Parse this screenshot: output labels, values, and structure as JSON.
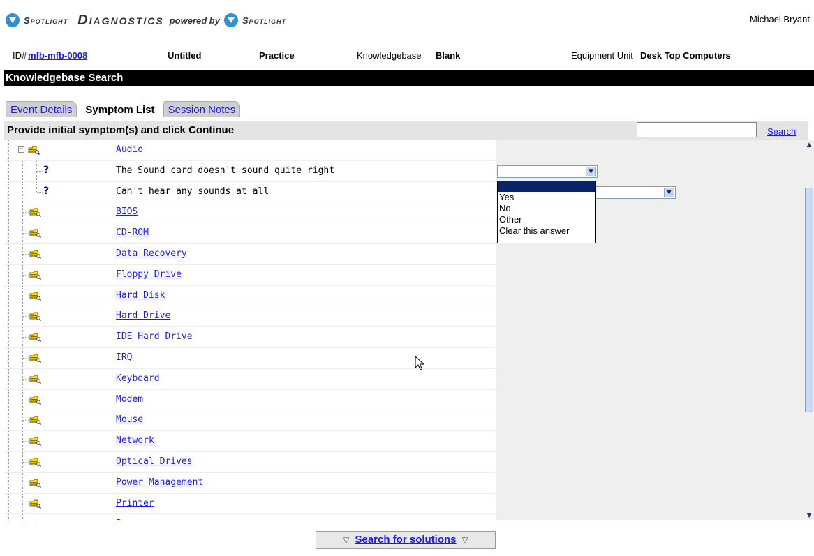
{
  "header": {
    "brand_small": "Spotlight",
    "brand_big": "Diagnostics",
    "powered_by": "powered by",
    "brand_small_2": "Spotlight",
    "user": "Michael Bryant"
  },
  "info": {
    "id_label": "ID#",
    "id_value": "mfb-mfb-0008",
    "title": "Untitled",
    "mode": "Practice",
    "kb_label": "Knowledgebase",
    "kb_value": "Blank",
    "eu_label": "Equipment Unit",
    "eu_value": "Desk Top Computers"
  },
  "section_title": "Knowledgebase Search",
  "tabs": [
    {
      "label": "Event Details",
      "active": false
    },
    {
      "label": "Symptom List",
      "active": true
    },
    {
      "label": "Session Notes",
      "active": false
    }
  ],
  "instruction": "Provide initial symptom(s) and click Continue",
  "search": {
    "value": "",
    "button": "Search"
  },
  "tree": {
    "expanded": {
      "label": "Audio",
      "children": [
        "The Sound card doesn't sound quite right",
        "Can't hear any sounds at all"
      ]
    },
    "categories": [
      "BIOS",
      "CD-ROM",
      "Data Recovery",
      "Floppy Drive",
      "Hard Disk",
      "Hard Drive",
      "IDE Hard Drive",
      "IRQ",
      "Keyboard",
      "Modem",
      "Mouse",
      "Network",
      "Optical Drives",
      "Power Management",
      "Printer",
      "Processor"
    ]
  },
  "dropdown": {
    "options": [
      "",
      "Yes",
      "No",
      "Other",
      "Clear this answer"
    ],
    "selected_index": 0
  },
  "bottom_button": "Search for solutions",
  "colors": {
    "link": "#1a1aff",
    "title_bar": "#000000",
    "logo": "#2f8fd8",
    "selection": "#0a246a"
  }
}
